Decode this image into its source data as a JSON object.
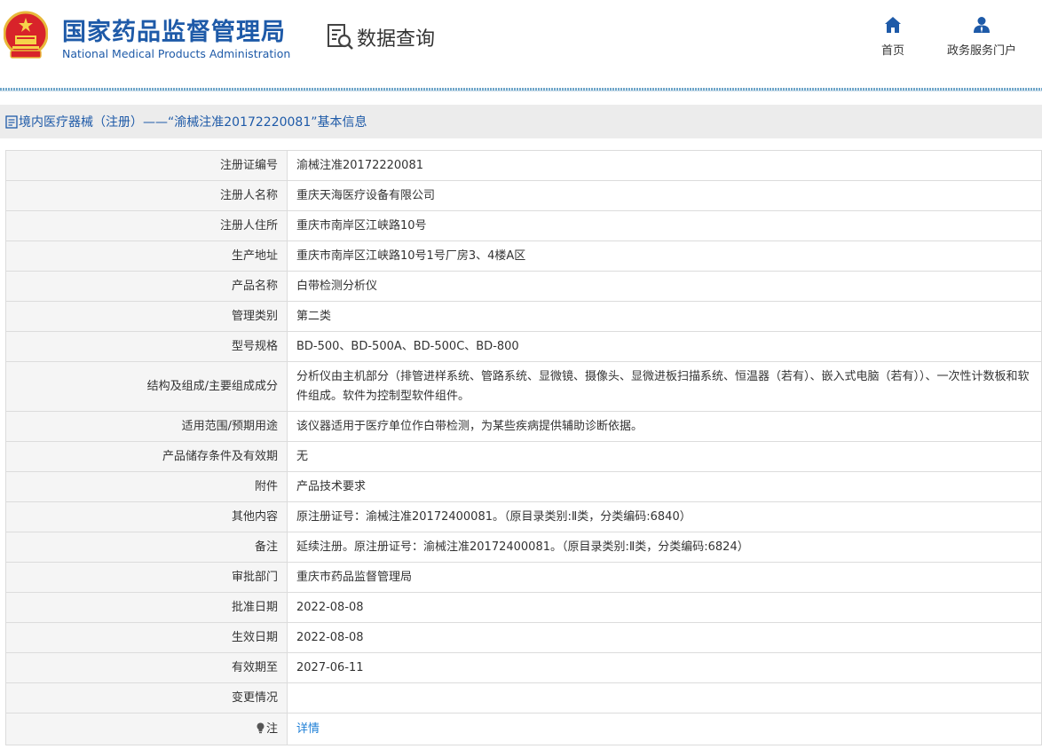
{
  "header": {
    "site_title_cn": "国家药品监督管理局",
    "site_title_en": "National Medical Products Administration",
    "query_label": "数据查询",
    "nav": [
      {
        "label": "首页",
        "icon": "home-icon"
      },
      {
        "label": "政务服务门户",
        "icon": "user-icon"
      }
    ]
  },
  "breadcrumb": {
    "text": "境内医疗器械（注册）——“渝械注准20172220081”基本信息",
    "icon": "document-icon"
  },
  "colors": {
    "brand_blue": "#1e5aa8",
    "link_blue": "#1e7fd6",
    "label_bg": "#f5f5f5",
    "crumb_bg": "#ececec",
    "border": "#dcdcdc"
  },
  "rows": [
    {
      "label": "注册证编号",
      "value": "渝械注准20172220081"
    },
    {
      "label": "注册人名称",
      "value": "重庆天海医疗设备有限公司"
    },
    {
      "label": "注册人住所",
      "value": "重庆市南岸区江峡路10号"
    },
    {
      "label": "生产地址",
      "value": "重庆市南岸区江峡路10号1号厂房3、4楼A区"
    },
    {
      "label": "产品名称",
      "value": "白带检测分析仪"
    },
    {
      "label": "管理类别",
      "value": "第二类"
    },
    {
      "label": "型号规格",
      "value": "BD-500、BD-500A、BD-500C、BD-800"
    },
    {
      "label": "结构及组成/主要组成成分",
      "value": "分析仪由主机部分（排管进样系统、管路系统、显微镜、摄像头、显微进板扫描系统、恒温器（若有）、嵌入式电脑（若有））、一次性计数板和软件组成。软件为控制型软件组件。"
    },
    {
      "label": "适用范围/预期用途",
      "value": "该仪器适用于医疗单位作白带检测，为某些疾病提供辅助诊断依据。"
    },
    {
      "label": "产品储存条件及有效期",
      "value": "无"
    },
    {
      "label": "附件",
      "value": "产品技术要求"
    },
    {
      "label": "其他内容",
      "value": "原注册证号：渝械注准20172400081。（原目录类别:Ⅱ类，分类编码:6840）"
    },
    {
      "label": "备注",
      "value": "延续注册。原注册证号：渝械注准20172400081。（原目录类别:Ⅱ类，分类编码:6824）"
    },
    {
      "label": "审批部门",
      "value": "重庆市药品监督管理局"
    },
    {
      "label": "批准日期",
      "value": "2022-08-08"
    },
    {
      "label": "生效日期",
      "value": "2022-08-08"
    },
    {
      "label": "有效期至",
      "value": "2027-06-11"
    },
    {
      "label": "变更情况",
      "value": ""
    }
  ],
  "note_row": {
    "label": "注",
    "link": "详情",
    "icon": "lightbulb-icon"
  }
}
